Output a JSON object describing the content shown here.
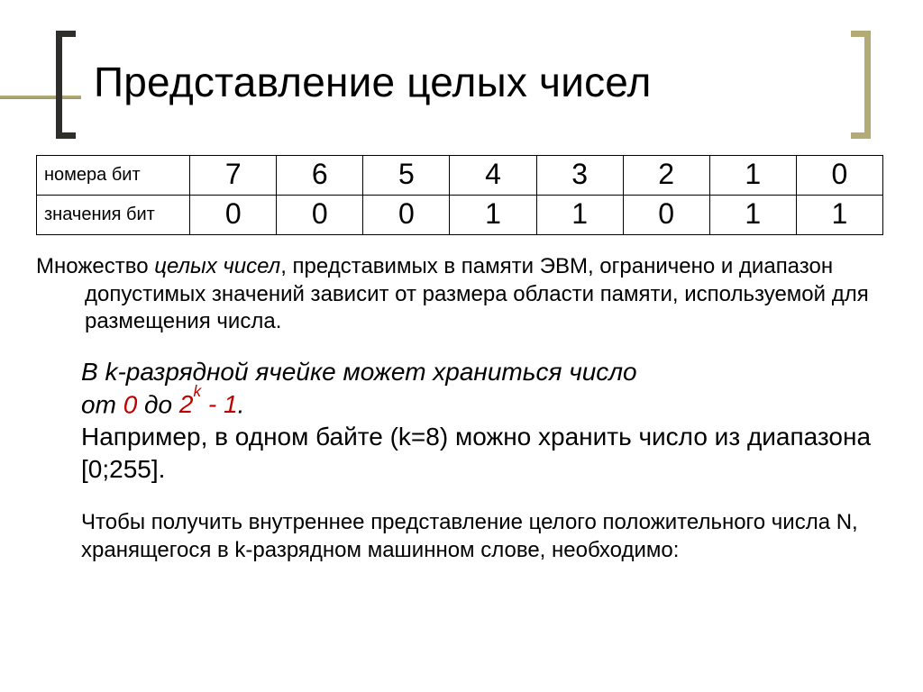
{
  "title": "Представление целых чисел",
  "table": {
    "row_label_1": "номера бит",
    "row_label_2": "значения бит",
    "bit_numbers": [
      "7",
      "6",
      "5",
      "4",
      "3",
      "2",
      "1",
      "0"
    ],
    "bit_values": [
      "0",
      "0",
      "0",
      "1",
      "1",
      "0",
      "1",
      "1"
    ]
  },
  "para1": {
    "lead": "Множество ",
    "ital": "целых чисел",
    "rest": ", представимых в памяти ЭВМ, ограничено и диапазон допустимых значений зависит от размера области памяти, используемой для размещения числа."
  },
  "para2": {
    "l1_a": "В k-разрядной ячейке может храниться число",
    "l2_a": "от ",
    "l2_zero": "0",
    "l2_b": " до ",
    "l2_pow_base": "2",
    "l2_pow_exp": "k",
    "l2_tail": " - 1",
    "l2_dot": ".",
    "l3": "Например, в одном байте (k=8) можно хранить число из диапазона [0;255]."
  },
  "para3": "Чтобы получить внутреннее представление целого положительного числа N, хранящегося в k-разрядном машинном слове, необходимо:"
}
